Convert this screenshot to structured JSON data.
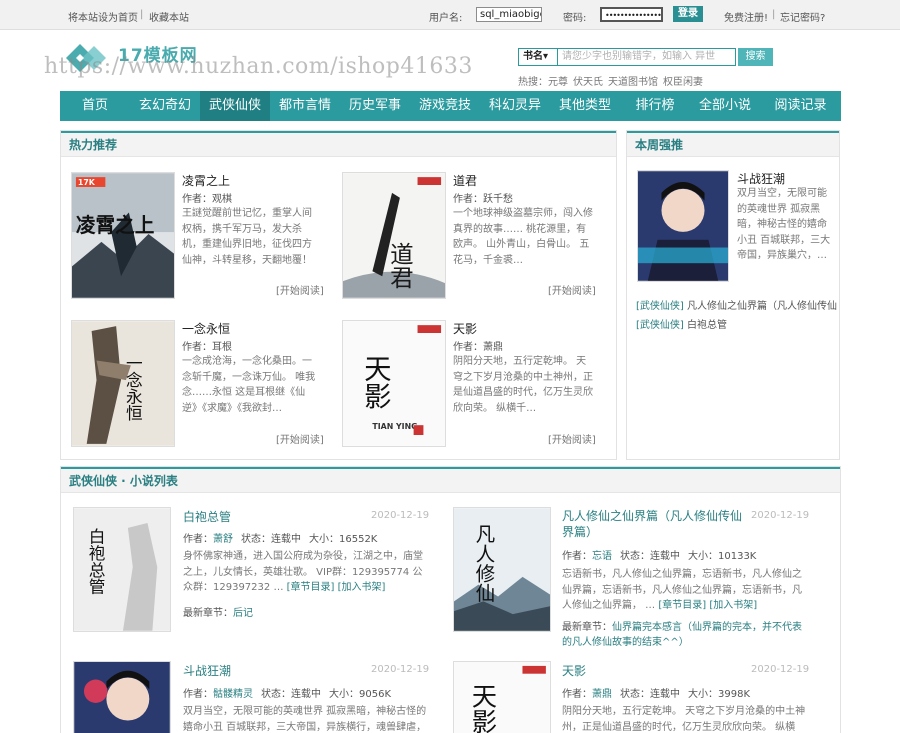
{
  "topbar": {
    "set_home": "将本站设为首页",
    "separator": "|",
    "bookmark": "收藏本站",
    "username_label": "用户名:",
    "username_value": "sql_miaobige",
    "password_label": "密码:",
    "password_value": "••••••••••••••••",
    "login_button": "登录",
    "register": "免费注册!",
    "forgot": "忘记密码?"
  },
  "logo": {
    "text": "17模板网",
    "watermark": "https://www.huzhan.com/ishop41633"
  },
  "search": {
    "select_value": "书名▾",
    "placeholder": "请您少字也别输错字，如输入 异世",
    "button": "搜索",
    "hot_label": "热搜：",
    "hot_items": [
      "元尊",
      "伏天氏",
      "天道图书馆",
      "权臣闲妻"
    ]
  },
  "nav": {
    "items": [
      "首页",
      "玄幻奇幻",
      "武侠仙侠",
      "都市言情",
      "历史军事",
      "游戏竞技",
      "科幻灵异",
      "其他类型",
      "排行榜",
      "全部小说",
      "阅读记录"
    ],
    "active_index": 2
  },
  "hot_recommend": {
    "title": "热力推荐",
    "read_label": "[开始阅读]",
    "books": [
      {
        "title": "凌霄之上",
        "author_label": "作者：",
        "author": "观棋",
        "desc": "王謎觉醒前世记忆，重掌人间权柄，携千军万马，发大杀机，重建仙界旧地，征伐四方仙神，斗转星移，天翻地覆！ …"
      },
      {
        "title": "道君",
        "author_label": "作者：",
        "author": "跃千愁",
        "desc": "一个地球神级盗墓宗师，闯入修真界的故事…… 桃花源里，有欧声。 山外青山，白骨山。 五花马，千金裘…"
      },
      {
        "title": "一念永恒",
        "author_label": "作者：",
        "author": "耳根",
        "desc": "一念成沧海，一念化桑田。一念斩千魔，一念诛万仙。 唯我念……永恒 这是耳根继《仙逆》《求魔》《我欲封…"
      },
      {
        "title": "天影",
        "author_label": "作者：",
        "author": "萧鼎",
        "desc": "阴阳分天地，五行定乾坤。 天穹之下岁月沧桑的中土神州，正是仙道昌盛的时代，亿万生灵欣欣向荣。 纵横千…"
      }
    ]
  },
  "weekly": {
    "title": "本周强推",
    "top_book": {
      "title": "斗战狂潮",
      "desc": "双月当空，无限可能的英魂世界 孤寂黑暗，神秘古怪的嬉命小丑 百城联邦，三大帝国，异族巢穴，…"
    },
    "links": [
      {
        "tag": "[武侠仙侠]",
        "name": "凡人修仙之仙界篇（凡人修仙传仙"
      },
      {
        "tag": "[武侠仙侠]",
        "name": "白袍总管"
      }
    ]
  },
  "list": {
    "title": "武侠仙侠 · 小说列表",
    "author_label": "作者：",
    "status_label": "状态：",
    "size_label": "大小：",
    "chapter_links": "[章节目录] [加入书架]",
    "latest_label": "最新章节：",
    "books": [
      {
        "title": "白袍总管",
        "date": "2020-12-19",
        "author": "萧舒",
        "status": "连载中",
        "size": "16552K",
        "desc": "身怀佛家神通，进入国公府成为杂役，江湖之中，庙堂之上，儿女情长，英雄壮歌。 VIP群：129395774 公众群：129397232 …",
        "latest": "后记"
      },
      {
        "title": "凡人修仙之仙界篇（凡人修仙传仙界篇）",
        "date": "2020-12-19",
        "author": "忘语",
        "status": "连载中",
        "size": "10133K",
        "desc": "忘语新书，凡人修仙之仙界篇，忘语新书，凡人修仙之仙界篇，忘语新书，凡人修仙之仙界篇，忘语新书，凡人修仙之仙界篇， …",
        "latest": "仙界篇完本感言（仙界篇的完本，并不代表的凡人修仙故事的结束^^）"
      },
      {
        "title": "斗战狂潮",
        "date": "2020-12-19",
        "author": "骷髅精灵",
        "status": "连载中",
        "size": "9056K",
        "desc": "双月当空，无限可能的英魂世界 孤寂黑暗，神秘古怪的嬉命小丑 百城联邦，三大帝国，异族横行，魂兽肆虐，这是…"
      },
      {
        "title": "天影",
        "date": "2020-12-19",
        "author": "萧鼎",
        "status": "连载中",
        "size": "3998K",
        "desc": "阴阳分天地，五行定乾坤。 天穹之下岁月沧桑的中土神州，正是仙道昌盛的时代，亿万生灵欣欣向荣。 纵横千…"
      }
    ]
  },
  "covers": {
    "c0": {
      "big": "凌霄之上",
      "badge": "17K"
    },
    "c1": {
      "big": "道君"
    },
    "c2": {
      "big": "一念永恒"
    },
    "c3": {
      "big": "天影",
      "sub": "TIAN YING"
    },
    "c5": {
      "big": "白袍总管"
    },
    "c6": {
      "big": "凡人修仙"
    }
  }
}
